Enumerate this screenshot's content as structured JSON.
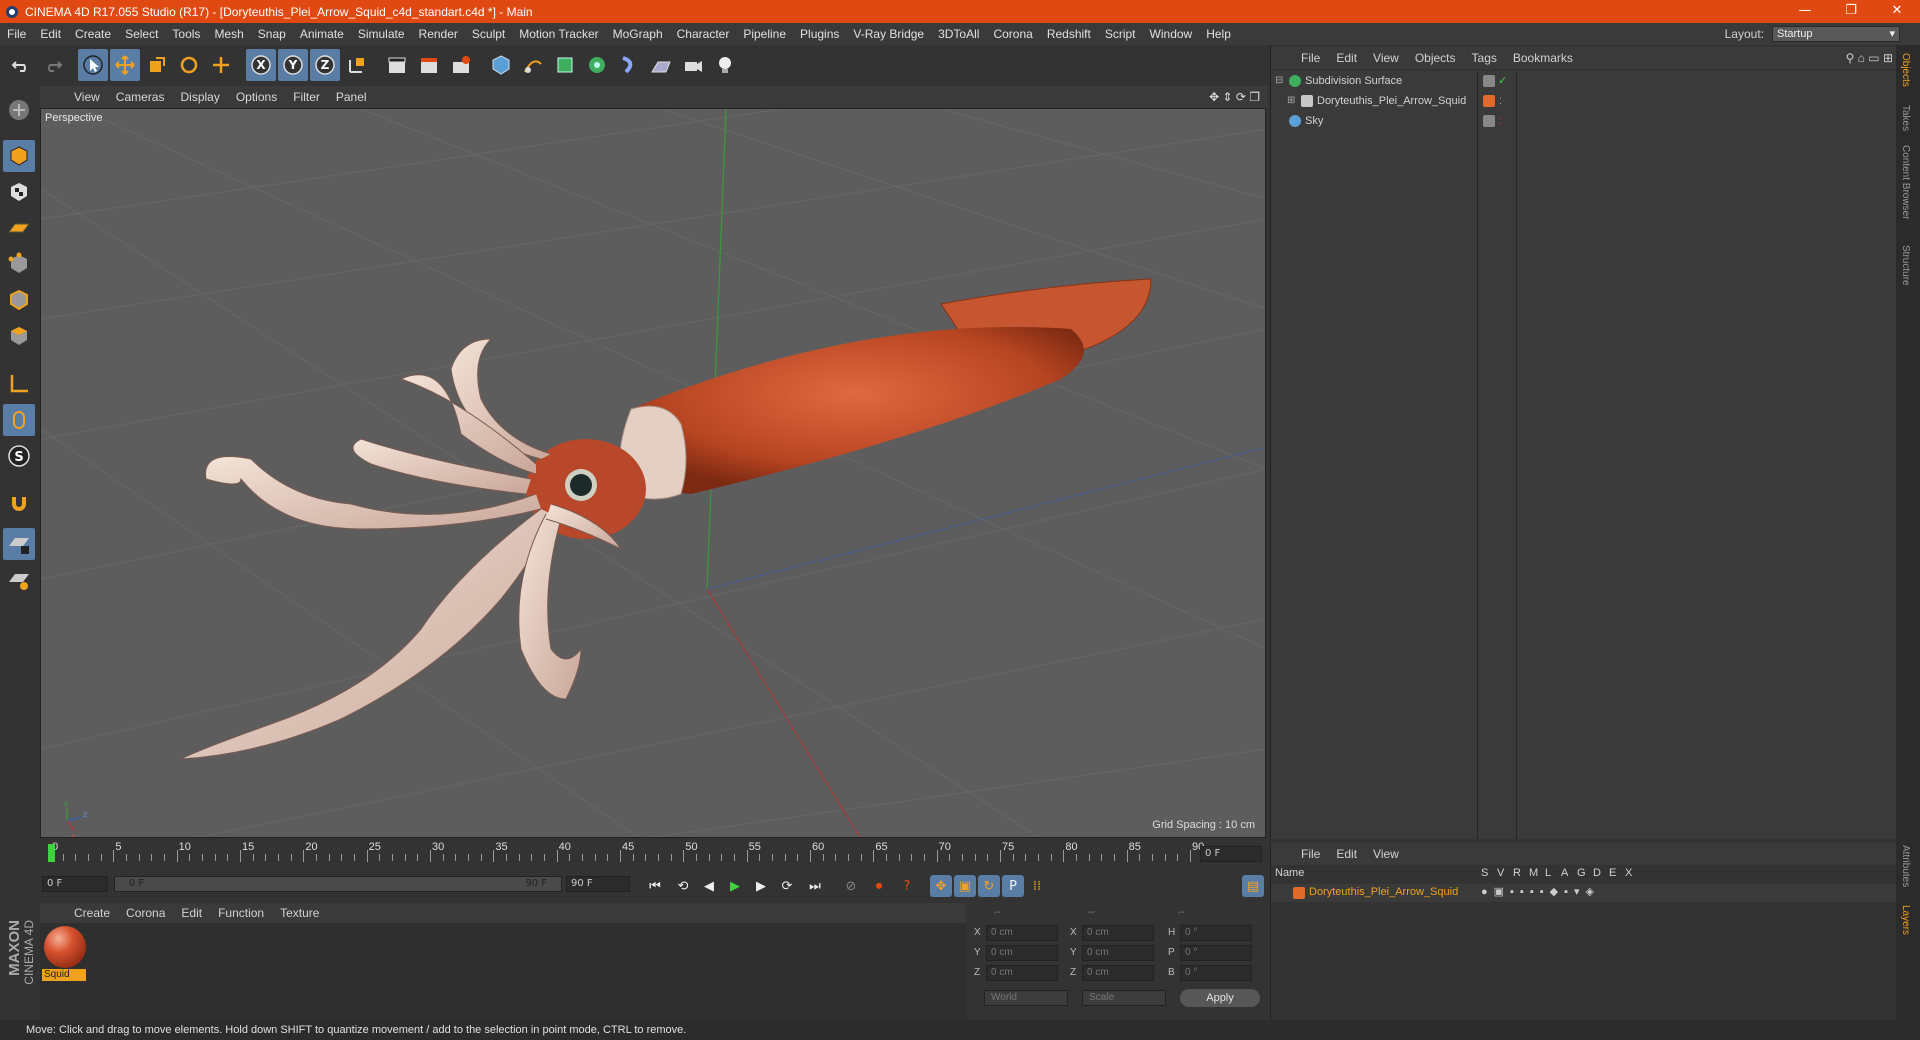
{
  "window": {
    "title": "CINEMA 4D R17.055 Studio (R17) - [Doryteuthis_Plei_Arrow_Squid_c4d_standart.c4d *] - Main",
    "minimize": "—",
    "maximize": "❐",
    "close": "✕"
  },
  "menu": [
    "File",
    "Edit",
    "Create",
    "Select",
    "Tools",
    "Mesh",
    "Snap",
    "Animate",
    "Simulate",
    "Render",
    "Sculpt",
    "Motion Tracker",
    "MoGraph",
    "Character",
    "Pipeline",
    "Plugins",
    "V-Ray Bridge",
    "3DToAll",
    "Corona",
    "Redshift",
    "Script",
    "Window",
    "Help"
  ],
  "layout": {
    "label": "Layout:",
    "value": "Startup"
  },
  "toolbar": {
    "x_label": "X",
    "y_label": "Y",
    "z_label": "Z"
  },
  "viewport": {
    "menu": [
      "View",
      "Cameras",
      "Display",
      "Options",
      "Filter",
      "Panel"
    ],
    "camera": "Perspective",
    "grid_spacing": "Grid Spacing : 10 cm",
    "axis_y": "y",
    "axis_z": "z",
    "axis_x": "x"
  },
  "timeline": {
    "ticks": [
      "0",
      "5",
      "10",
      "15",
      "20",
      "25",
      "30",
      "35",
      "40",
      "45",
      "50",
      "55",
      "60",
      "65",
      "70",
      "75",
      "80",
      "85",
      "90"
    ],
    "current_frame": "0 F",
    "start": "0 F",
    "range_start": "0 F",
    "range_end": "90 F",
    "end": "90 F"
  },
  "material_panel": {
    "menu": [
      "Create",
      "Corona",
      "Edit",
      "Function",
      "Texture"
    ],
    "material_name": "Squid"
  },
  "coordinates": {
    "headers": [
      "--",
      "--",
      "--"
    ],
    "rows": [
      {
        "a": "X",
        "av": "0 cm",
        "b": "X",
        "bv": "0 cm",
        "c": "H",
        "cv": "0 °"
      },
      {
        "a": "Y",
        "av": "0 cm",
        "b": "Y",
        "bv": "0 cm",
        "c": "P",
        "cv": "0 °"
      },
      {
        "a": "Z",
        "av": "0 cm",
        "b": "Z",
        "bv": "0 cm",
        "c": "B",
        "cv": "0 °"
      }
    ],
    "space": "World",
    "mode": "Scale",
    "apply": "Apply"
  },
  "objects_panel": {
    "menu": [
      "File",
      "Edit",
      "View",
      "Objects",
      "Tags",
      "Bookmarks"
    ],
    "items": [
      {
        "name": "Subdivision Surface"
      },
      {
        "name": "Doryteuthis_Plei_Arrow_Squid"
      },
      {
        "name": "Sky"
      }
    ]
  },
  "layers_panel": {
    "menu": [
      "File",
      "Edit",
      "View"
    ],
    "columns": [
      "Name",
      "S",
      "V",
      "R",
      "M",
      "L",
      "A",
      "G",
      "D",
      "E",
      "X"
    ],
    "layer": "Doryteuthis_Plei_Arrow_Squid"
  },
  "right_tabs": [
    "Objects",
    "Takes",
    "Content Browser",
    "Structure",
    "Attributes",
    "Layers"
  ],
  "brand": {
    "maxon": "MAXON",
    "product": "CINEMA 4D"
  },
  "status": "Move: Click and drag to move elements. Hold down SHIFT to quantize movement / add to the selection in point mode, CTRL to remove.",
  "colors": {
    "accent": "#e04a12",
    "selected": "#5a7da6",
    "material": "#f0a11e",
    "squid": "#c9522d"
  }
}
